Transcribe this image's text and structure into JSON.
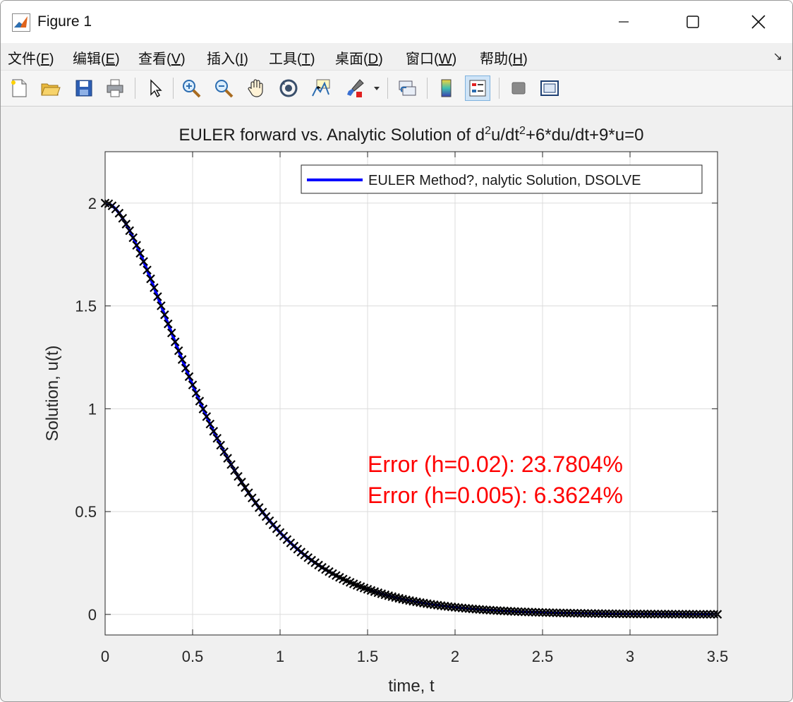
{
  "window": {
    "title": "Figure 1"
  },
  "menu": [
    {
      "label": "文件(",
      "accel": "F",
      "suffix": ")"
    },
    {
      "label": "编辑(",
      "accel": "E",
      "suffix": ")"
    },
    {
      "label": "查看(",
      "accel": "V",
      "suffix": ")"
    },
    {
      "label": "插入(",
      "accel": "I",
      "suffix": ")"
    },
    {
      "label": "工具(",
      "accel": "T",
      "suffix": ")"
    },
    {
      "label": "桌面(",
      "accel": "D",
      "suffix": ")"
    },
    {
      "label": "窗口(",
      "accel": "W",
      "suffix": ")"
    },
    {
      "label": "帮助(",
      "accel": "H",
      "suffix": ")"
    }
  ],
  "toolbar_icons": [
    "new-figure-icon",
    "open-file-icon",
    "save-icon",
    "print-icon",
    "select-pointer-icon",
    "zoom-in-icon",
    "zoom-out-icon",
    "pan-hand-icon",
    "rotate-3d-icon",
    "data-cursor-icon",
    "brush-icon",
    "link-plot-icon",
    "colorbar-icon",
    "legend-icon",
    "hide-plot-tools-icon",
    "show-plot-tools-icon"
  ],
  "chart_data": {
    "type": "line",
    "title_parts": [
      "EULER forward vs. Analytic Solution of d",
      "2",
      "u/dt",
      "2",
      "+6*du/dt+9*u=0"
    ],
    "xlabel": "time, t",
    "ylabel": "Solution, u(t)",
    "xlim": [
      0,
      3.5
    ],
    "ylim": [
      -0.1,
      2.25
    ],
    "xticks": [
      "0",
      "0.5",
      "1",
      "1.5",
      "2",
      "2.5",
      "3",
      "3.5"
    ],
    "yticks": [
      "0",
      "0.5",
      "1",
      "1.5",
      "2"
    ],
    "grid": true,
    "legend": {
      "location": "top-right",
      "entries": [
        "EULER Method?, nalytic Solution, DSOLVE"
      ]
    },
    "series": [
      {
        "name": "EULER Method?, nalytic Solution, DSOLVE",
        "style": "line",
        "color": "#0000ff",
        "formula": "u(t) = 2*(1+3*t)*exp(-3*t)",
        "x_range": [
          0,
          3.5
        ],
        "step": 0.02
      },
      {
        "style": "markers",
        "marker": "x",
        "color": "#000000",
        "formula": "u(t) = 2*(1+3*t)*exp(-3*t)",
        "x_range": [
          0,
          3.5
        ],
        "step": 0.02
      }
    ],
    "sample_values": {
      "x": [
        0,
        0.5,
        1,
        1.5,
        2,
        2.5,
        3,
        3.5
      ],
      "y": [
        2.0,
        1.116,
        0.398,
        0.122,
        0.035,
        0.01,
        0.002,
        0.0006
      ]
    },
    "annotations": [
      {
        "text": "Error (h=0.02): 23.7804%",
        "x": 1.5,
        "y": 0.73,
        "color": "#ff0000"
      },
      {
        "text": "Error (h=0.005): 6.3624%",
        "x": 1.5,
        "y": 0.58,
        "color": "#ff0000"
      }
    ]
  }
}
